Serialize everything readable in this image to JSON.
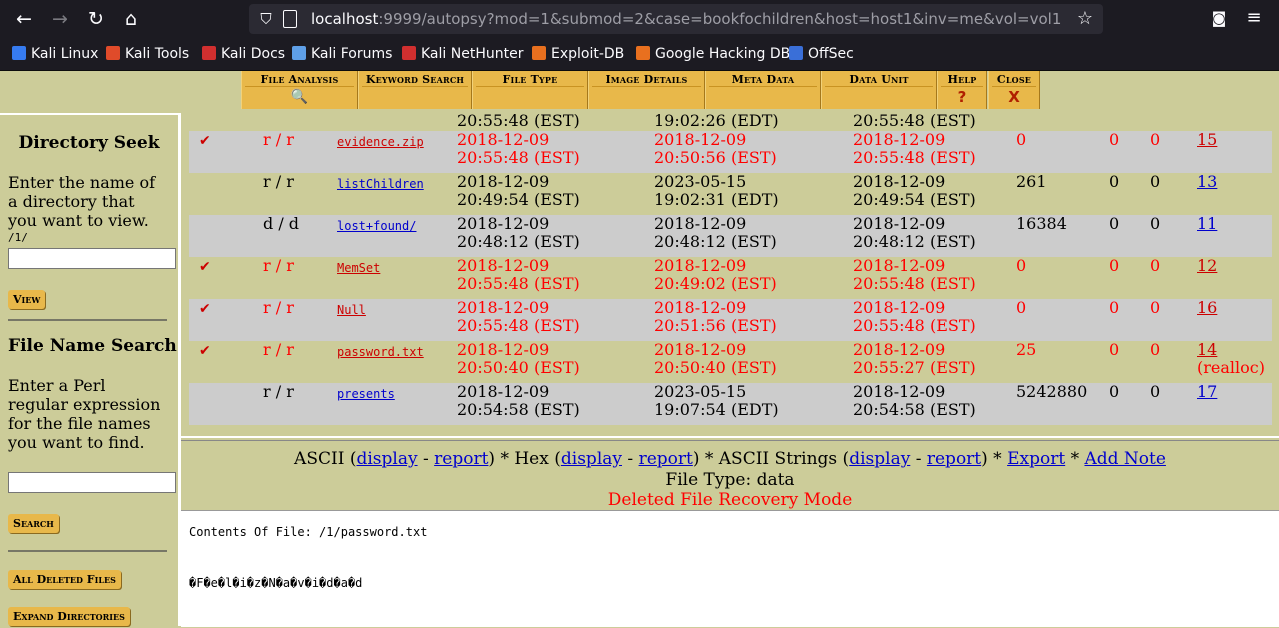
{
  "browser": {
    "url_host": "localhost",
    "url_rest": ":9999/autopsy?mod=1&submod=2&case=bookfochildren&host=host1&inv=me&vol=vol1",
    "bookmarks": [
      "Kali Linux",
      "Kali Tools",
      "Kali Docs",
      "Kali Forums",
      "Kali NetHunter",
      "Exploit-DB",
      "Google Hacking DB",
      "OffSec"
    ],
    "bookmark_colors": [
      "#367bf0",
      "#e04b2a",
      "#d12f2f",
      "#5fa0e8",
      "#d12f2f",
      "#e8701f",
      "#e8701f",
      "#3a6fd8"
    ]
  },
  "tabs": [
    {
      "label": "File Analysis",
      "sub": "🔍"
    },
    {
      "label": "Keyword Search",
      "sub": ""
    },
    {
      "label": "File Type",
      "sub": ""
    },
    {
      "label": "Image Details",
      "sub": ""
    },
    {
      "label": "Meta Data",
      "sub": ""
    },
    {
      "label": "Data Unit",
      "sub": ""
    },
    {
      "label": "Help",
      "sub": "?"
    },
    {
      "label": "Close",
      "sub": "X"
    }
  ],
  "left": {
    "dir_title": "Directory Seek",
    "dir_desc": [
      "Enter the name of",
      "a directory that",
      "you want to view."
    ],
    "dir_value": "/1/",
    "view_button": "View",
    "fn_title": "File Name Search",
    "fn_desc": [
      "Enter a Perl",
      "regular expression",
      "for the file names",
      "you want to find."
    ],
    "search_button": "Search",
    "all_deleted_button": "All Deleted Files",
    "expand_button": "Expand Directories"
  },
  "partial_row": {
    "written_time": "20:55:48 (EST)",
    "accessed_time": "19:02:26 (EDT)",
    "changed_time": "20:55:48 (EST)"
  },
  "files": [
    {
      "deleted": true,
      "type": "r / r",
      "name": "evidence.zip",
      "written": [
        "2018-12-09",
        "20:55:48 (EST)"
      ],
      "accessed": [
        "2018-12-09",
        "20:50:56 (EST)"
      ],
      "changed": [
        "2018-12-09",
        "20:55:48 (EST)"
      ],
      "size": "0",
      "uid": "0",
      "gid": "0",
      "meta": "15",
      "note": ""
    },
    {
      "deleted": false,
      "type": "r / r",
      "name": "listChildren",
      "written": [
        "2018-12-09",
        "20:49:54 (EST)"
      ],
      "accessed": [
        "2023-05-15",
        "19:02:31 (EDT)"
      ],
      "changed": [
        "2018-12-09",
        "20:49:54 (EST)"
      ],
      "size": "261",
      "uid": "0",
      "gid": "0",
      "meta": "13",
      "note": ""
    },
    {
      "deleted": false,
      "type": "d / d",
      "name": "lost+found/",
      "written": [
        "2018-12-09",
        "20:48:12 (EST)"
      ],
      "accessed": [
        "2018-12-09",
        "20:48:12 (EST)"
      ],
      "changed": [
        "2018-12-09",
        "20:48:12 (EST)"
      ],
      "size": "16384",
      "uid": "0",
      "gid": "0",
      "meta": "11",
      "note": ""
    },
    {
      "deleted": true,
      "type": "r / r",
      "name": "MemSet",
      "written": [
        "2018-12-09",
        "20:55:48 (EST)"
      ],
      "accessed": [
        "2018-12-09",
        "20:49:02 (EST)"
      ],
      "changed": [
        "2018-12-09",
        "20:55:48 (EST)"
      ],
      "size": "0",
      "uid": "0",
      "gid": "0",
      "meta": "12",
      "note": ""
    },
    {
      "deleted": true,
      "type": "r / r",
      "name": "Null",
      "written": [
        "2018-12-09",
        "20:55:48 (EST)"
      ],
      "accessed": [
        "2018-12-09",
        "20:51:56 (EST)"
      ],
      "changed": [
        "2018-12-09",
        "20:55:48 (EST)"
      ],
      "size": "0",
      "uid": "0",
      "gid": "0",
      "meta": "16",
      "note": ""
    },
    {
      "deleted": true,
      "type": "r / r",
      "name": "password.txt",
      "written": [
        "2018-12-09",
        "20:50:40 (EST)"
      ],
      "accessed": [
        "2018-12-09",
        "20:50:40 (EST)"
      ],
      "changed": [
        "2018-12-09",
        "20:55:27 (EST)"
      ],
      "size": "25",
      "uid": "0",
      "gid": "0",
      "meta": "14",
      "note": "(realloc)"
    },
    {
      "deleted": false,
      "type": "r / r",
      "name": "presents",
      "written": [
        "2018-12-09",
        "20:54:58 (EST)"
      ],
      "accessed": [
        "2023-05-15",
        "19:07:54 (EDT)"
      ],
      "changed": [
        "2018-12-09",
        "20:54:58 (EST)"
      ],
      "size": "5242880",
      "uid": "0",
      "gid": "0",
      "meta": "17",
      "note": ""
    }
  ],
  "info": {
    "ascii": "ASCII",
    "hex": "Hex",
    "strings": "ASCII Strings",
    "display": "display",
    "report": "report",
    "export": "Export",
    "add_note": "Add Note",
    "file_type": "File Type: data",
    "mode": "Deleted File Recovery Mode"
  },
  "content": {
    "heading": "Contents Of File: /1/password.txt",
    "body": "�F�e�l�i�z�N�a�v�i�d�a�d"
  },
  "colors": {
    "accent": "#e8b84a",
    "background": "#cccc99",
    "deleted": "#ff0000",
    "link": "#0000cc"
  }
}
